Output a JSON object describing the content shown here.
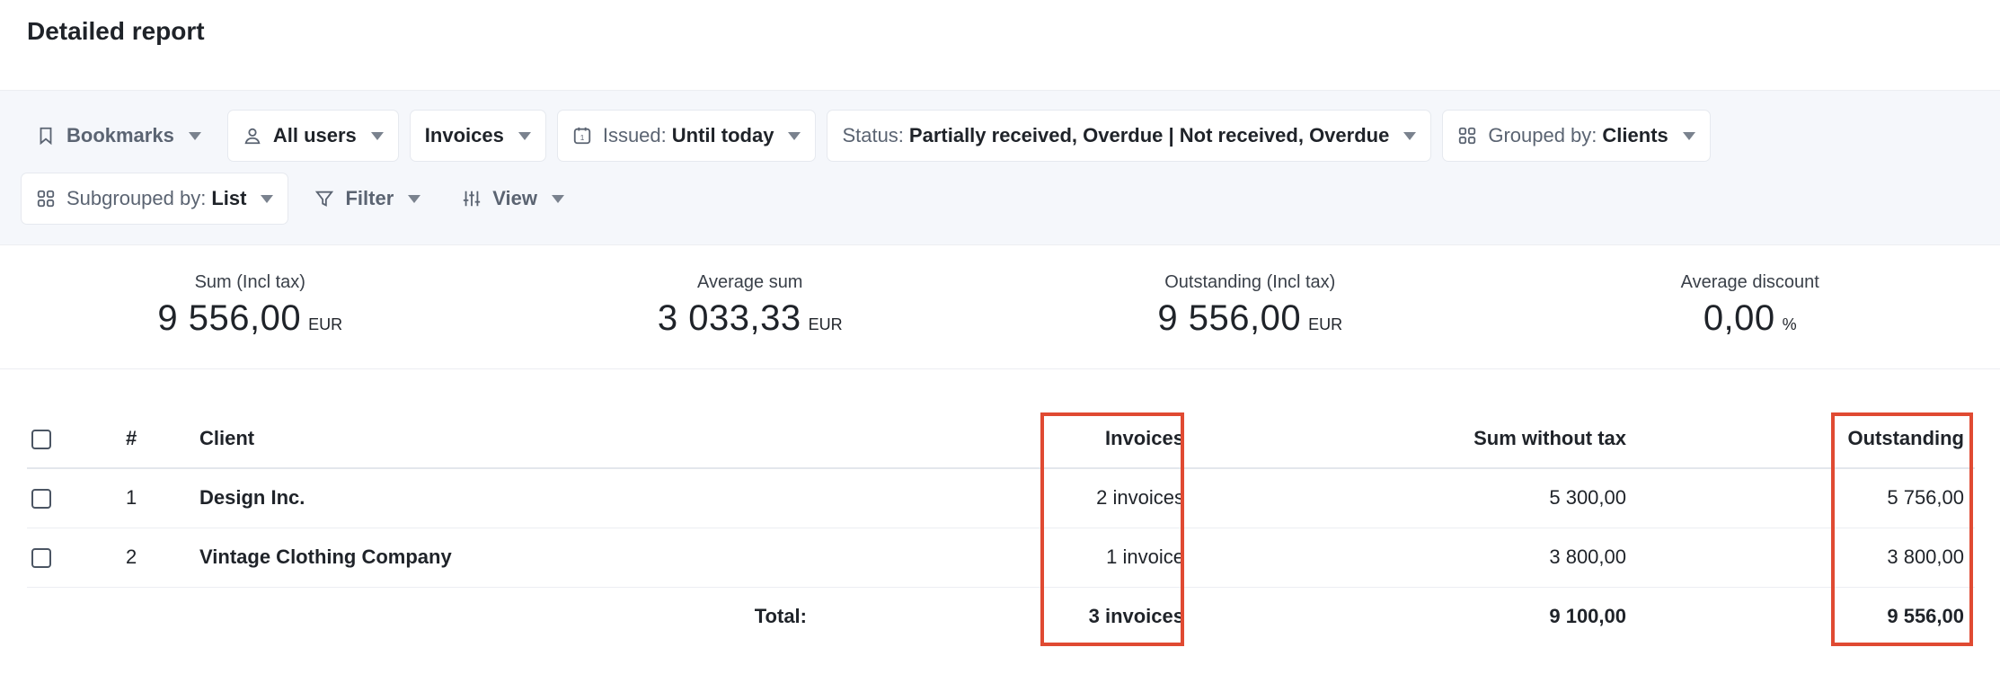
{
  "page": {
    "title": "Detailed report"
  },
  "filters": {
    "bookmarks": "Bookmarks",
    "users": "All users",
    "document_type": "Invoices",
    "issued_label": "Issued:",
    "issued_value": "Until today",
    "status_label": "Status:",
    "status_value": "Partially received, Overdue | Not received, Overdue",
    "grouped_label": "Grouped by:",
    "grouped_value": "Clients",
    "subgrouped_label": "Subgrouped by:",
    "subgrouped_value": "List",
    "filter": "Filter",
    "view": "View",
    "calendar_day": "1"
  },
  "stats": [
    {
      "label": "Sum (Incl tax)",
      "value": "9 556,00",
      "unit": "EUR"
    },
    {
      "label": "Average sum",
      "value": "3 033,33",
      "unit": "EUR"
    },
    {
      "label": "Outstanding (Incl tax)",
      "value": "9 556,00",
      "unit": "EUR"
    },
    {
      "label": "Average discount",
      "value": "0,00",
      "unit": "%"
    }
  ],
  "table": {
    "headers": {
      "num": "#",
      "client": "Client",
      "invoices": "Invoices",
      "sum_without_tax": "Sum without tax",
      "outstanding": "Outstanding"
    },
    "rows": [
      {
        "num": "1",
        "client": "Design Inc.",
        "invoices": "2 invoices",
        "sum_without_tax": "5 300,00",
        "outstanding": "5 756,00"
      },
      {
        "num": "2",
        "client": "Vintage Clothing Company",
        "invoices": "1 invoice",
        "sum_without_tax": "3 800,00",
        "outstanding": "3 800,00"
      }
    ],
    "total": {
      "label": "Total:",
      "invoices": "3 invoices",
      "sum_without_tax": "9 100,00",
      "outstanding": "9 556,00"
    }
  },
  "colors": {
    "highlight": "#e04a32",
    "filter_bg": "#f5f7fb"
  }
}
